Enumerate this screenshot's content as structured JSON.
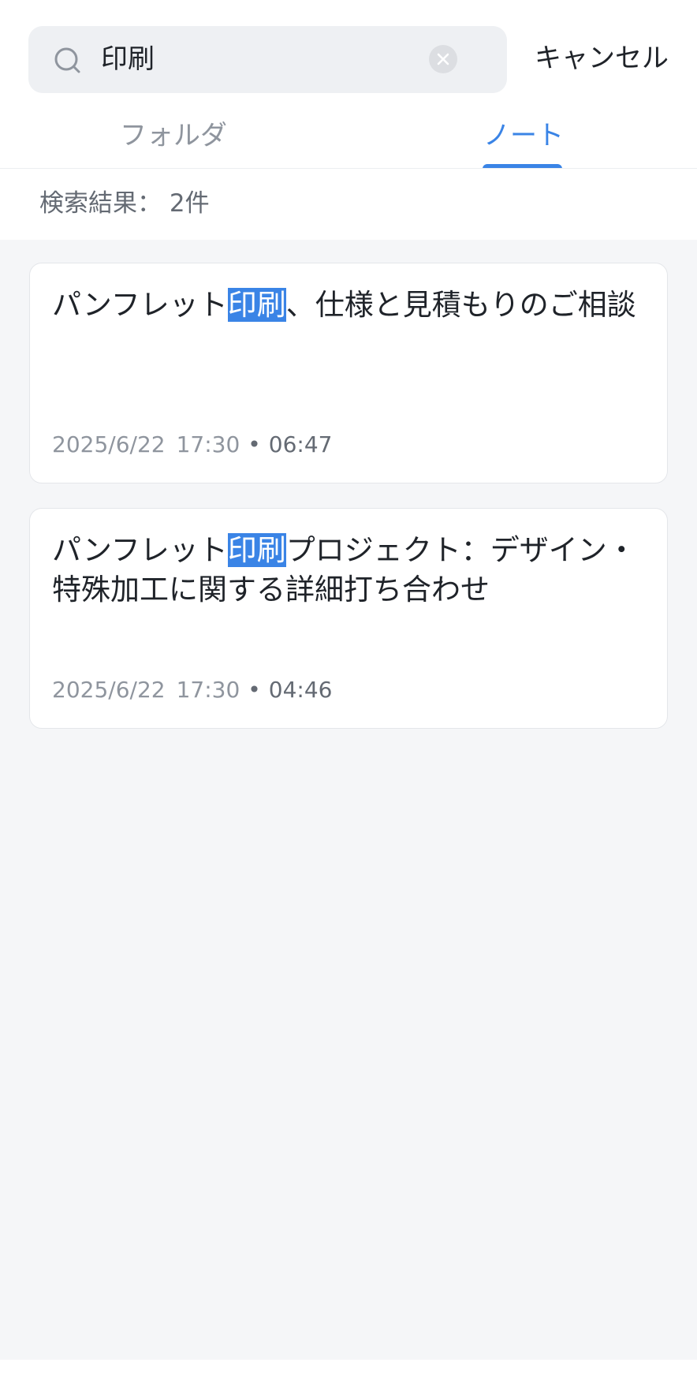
{
  "search": {
    "query": "印刷",
    "cancel_label": "キャンセル"
  },
  "tabs": [
    {
      "label": "フォルダ",
      "active": false
    },
    {
      "label": "ノート",
      "active": true
    }
  ],
  "results": {
    "count_label": "検索結果：",
    "count_value": "2件"
  },
  "notes": [
    {
      "title_before": "パンフレット",
      "title_highlight": "印刷",
      "title_after": "、仕様と見積もりのご相談",
      "date": "2025/6/22",
      "time": "17:30",
      "separator": "•",
      "duration": "06:47"
    },
    {
      "title_before": "パンフレット",
      "title_highlight": "印刷",
      "title_after": "プロジェクト：デザイン・特殊加工に関する詳細打ち合わせ",
      "date": "2025/6/22",
      "time": "17:30",
      "separator": "•",
      "duration": "04:46"
    }
  ],
  "colors": {
    "accent": "#3a84e6",
    "background": "#f5f6f8",
    "highlight_text": "#ffffff"
  }
}
